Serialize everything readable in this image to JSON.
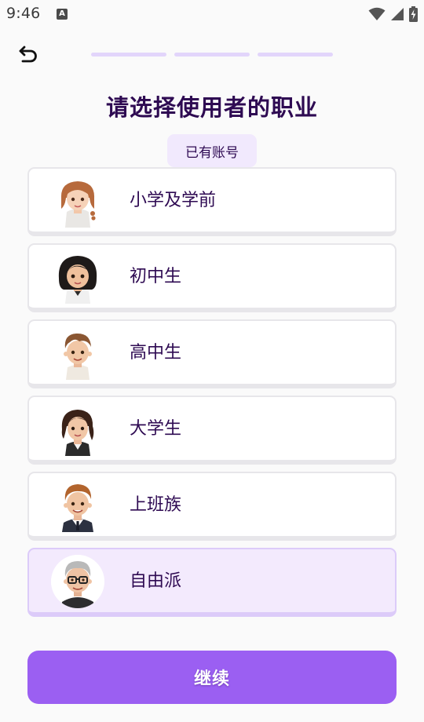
{
  "status_bar": {
    "time": "9:46",
    "notification_badge": "A",
    "icons": [
      "wifi-icon",
      "cell-signal-icon",
      "battery-charging-icon"
    ]
  },
  "header": {
    "back_icon": "undo-arrow-icon",
    "progress_steps": 3
  },
  "title": "请选择使用者的职业",
  "account_chip": "已有账号",
  "options": [
    {
      "label": "小学及学前",
      "avatar": "girl-braids-avatar",
      "selected": false
    },
    {
      "label": "初中生",
      "avatar": "girl-bob-hair-avatar",
      "selected": false
    },
    {
      "label": "高中生",
      "avatar": "boy-avatar",
      "selected": false
    },
    {
      "label": "大学生",
      "avatar": "young-woman-avatar",
      "selected": false
    },
    {
      "label": "上班族",
      "avatar": "man-suit-avatar",
      "selected": false
    },
    {
      "label": "自由派",
      "avatar": "older-man-glasses-avatar",
      "selected": true
    }
  ],
  "continue_label": "继续",
  "colors": {
    "accent": "#9b5ff2",
    "title": "#2e0a52",
    "chip_bg": "#f1e9fd",
    "selected_bg": "#f3eafd",
    "progress": "#e2d5fb"
  }
}
